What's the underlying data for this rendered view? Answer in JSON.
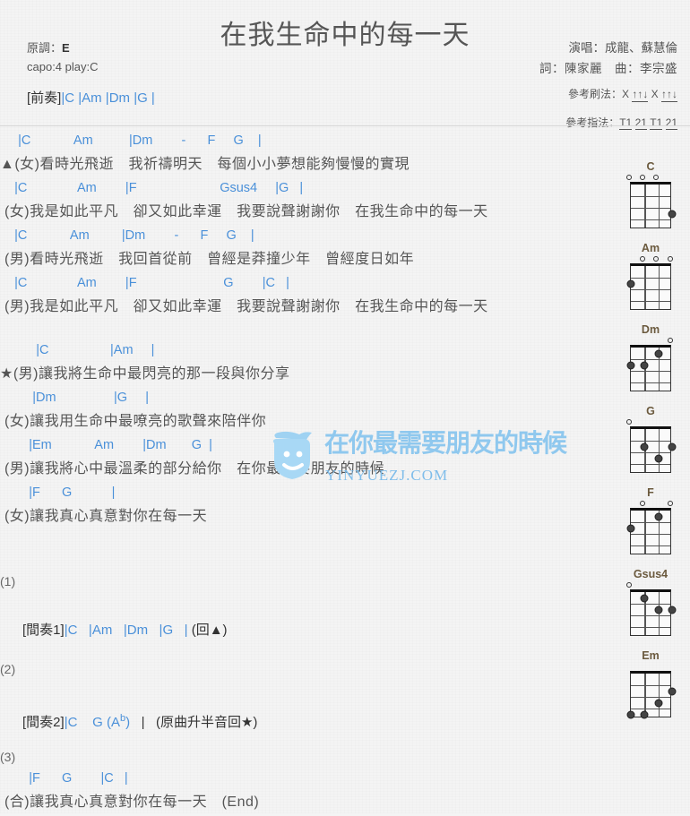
{
  "header": {
    "title": "在我生命中的每一天",
    "original_key_label": "原調：",
    "original_key": "E",
    "capo_line": "capo:4 play:C",
    "singer_line": "演唱：成龍、蘇慧倫",
    "credit_line": "詞：陳家麗　曲：李宗盛",
    "strum_label": "參考刷法：",
    "strum_pattern": "X ↑↑↓ X ↑↑↓",
    "finger_label": "參考指法：",
    "finger_pattern": "T1 21 T1 21"
  },
  "prelude": {
    "label": "[前奏]",
    "chords": "|C    |Am    |Dm    |G    |"
  },
  "sections": [
    {
      "id": "verse1-line1",
      "chords": "     |C            Am          |Dm        -      F     G    |",
      "lyric": "▲(女)看時光飛逝　我祈禱明天　每個小小夢想能夠慢慢的實現"
    },
    {
      "id": "verse1-line2",
      "chords": "    |C              Am        |F                       Gsus4     |G   |",
      "lyric": " (女)我是如此平凡　卻又如此幸運　我要說聲謝謝你　在我生命中的每一天"
    },
    {
      "id": "verse2-line1",
      "chords": "    |C            Am         |Dm        -      F     G    |",
      "lyric": " (男)看時光飛逝　我回首從前　曾經是莽撞少年　曾經度日如年"
    },
    {
      "id": "verse2-line2",
      "chords": "    |C              Am        |F                        G        |C   |",
      "lyric": " (男)我是如此平凡　卻又如此幸運　我要說聲謝謝你　在我生命中的每一天"
    },
    {
      "id": "chorus-line1",
      "chords": "          |C                 |Am     |",
      "lyric": "★(男)讓我將生命中最閃亮的那一段與你分享"
    },
    {
      "id": "chorus-line2",
      "chords": "         |Dm                |G     |",
      "lyric": " (女)讓我用生命中最嘹亮的歌聲來陪伴你"
    },
    {
      "id": "chorus-line3",
      "chords": "        |Em            Am        |Dm       G  |",
      "lyric": " (男)讓我將心中最溫柔的部分給你　在你最需要朋友的時候"
    },
    {
      "id": "chorus-line4",
      "chords": "        |F      G           |",
      "lyric": " (女)讓我真心真意對你在每一天"
    }
  ],
  "endings": [
    {
      "number": "(1)",
      "label": "[間奏1]",
      "chords_pre": "|C   |Am   |Dm   |G   |",
      "note": " (回▲)"
    },
    {
      "number": "(2)",
      "label": "[間奏2]",
      "chords_pre": "|C    G",
      "alt_chord_open": " (A",
      "alt_chord_flat": "b",
      "alt_chord_close": ")",
      "chords_post": "   |",
      "note": "   (原曲升半音回★)"
    }
  ],
  "final": {
    "number": "(3)",
    "chords": "        |F      G        |C   |",
    "lyric": " (合)讓我真心真意對你在每一天　(End)"
  },
  "diagrams": [
    {
      "name": "C",
      "open": [
        true,
        true,
        true,
        false
      ],
      "dots": [
        {
          "string": 4,
          "fret": 3
        }
      ]
    },
    {
      "name": "Am",
      "open": [
        false,
        true,
        true,
        true
      ],
      "dots": [
        {
          "string": 1,
          "fret": 2
        }
      ]
    },
    {
      "name": "Dm",
      "open": [
        false,
        false,
        false,
        true
      ],
      "dots": [
        {
          "string": 3,
          "fret": 1
        },
        {
          "string": 1,
          "fret": 2
        },
        {
          "string": 2,
          "fret": 2
        }
      ]
    },
    {
      "name": "G",
      "open": [
        true,
        false,
        false,
        false
      ],
      "dots": [
        {
          "string": 2,
          "fret": 2
        },
        {
          "string": 4,
          "fret": 2
        },
        {
          "string": 3,
          "fret": 3
        }
      ]
    },
    {
      "name": "F",
      "open": [
        false,
        true,
        false,
        true
      ],
      "dots": [
        {
          "string": 3,
          "fret": 1
        },
        {
          "string": 1,
          "fret": 2
        }
      ]
    },
    {
      "name": "Gsus4",
      "open": [
        true,
        false,
        false,
        false
      ],
      "dots": [
        {
          "string": 2,
          "fret": 1
        },
        {
          "string": 3,
          "fret": 2
        },
        {
          "string": 4,
          "fret": 2
        }
      ]
    },
    {
      "name": "Em",
      "open": [
        false,
        false,
        false,
        false
      ],
      "dots": [
        {
          "string": 4,
          "fret": 2
        },
        {
          "string": 3,
          "fret": 3
        },
        {
          "string": 1,
          "fret": 4
        },
        {
          "string": 2,
          "fret": 4
        }
      ]
    }
  ],
  "watermark": {
    "site": "YINYUEZJ.COM",
    "cn": "在你最需要朋友的時候"
  },
  "colors": {
    "chord_blue": "#4a90d9",
    "bar_brown": "#6b5a3e",
    "text_gray": "#555555",
    "page_bg": "#f4f4f4"
  }
}
